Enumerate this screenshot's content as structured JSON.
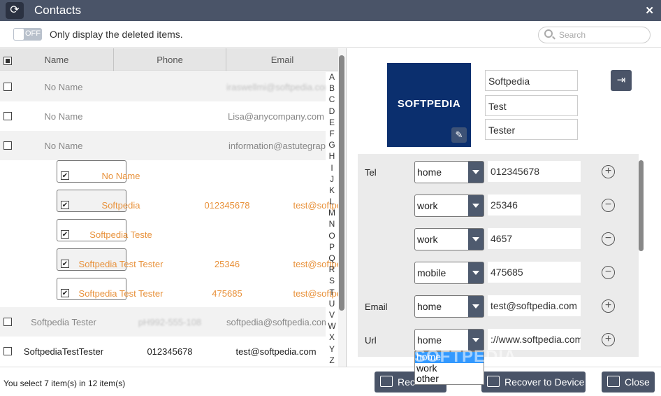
{
  "window": {
    "title": "Contacts",
    "close_glyph": "✕",
    "logo_icon": "refresh-logo-icon"
  },
  "filter": {
    "toggle_label": "OFF",
    "text": "Only display the deleted items.",
    "search_placeholder": "Search"
  },
  "table": {
    "headers": {
      "name": "Name",
      "phone": "Phone",
      "email": "Email"
    },
    "rows": [
      {
        "checked": false,
        "name": "No Name",
        "phone": "",
        "email": "iraswellmi@softpedia.com"
      },
      {
        "checked": false,
        "name": "No Name",
        "phone": "",
        "email": "Lisa@anycompany.com"
      },
      {
        "checked": false,
        "name": "No Name",
        "phone": "",
        "email": "information@astutegraph"
      },
      {
        "checked": true,
        "name": "No Name",
        "phone": "",
        "email": ""
      },
      {
        "checked": true,
        "name": "Softpedia",
        "phone": "012345678",
        "email": "test@softpedia.com"
      },
      {
        "checked": true,
        "name": "Softpedia  Teste",
        "phone": "",
        "email": ""
      },
      {
        "checked": true,
        "name": "Softpedia Test Tester",
        "phone": "25346",
        "email": "test@softpedia.com"
      },
      {
        "checked": true,
        "name": "Softpedia Test Tester",
        "phone": "475685",
        "email": "test@softpedia.com"
      },
      {
        "checked": false,
        "name": "Softpedia Tester",
        "phone": "pH992-555-108",
        "email": "softpedia@softpedia.com"
      },
      {
        "checked": false,
        "name": "SoftpediaTestTester",
        "phone": "012345678",
        "email": "test@softpedia.com"
      }
    ],
    "alphabet": [
      "A",
      "B",
      "C",
      "D",
      "E",
      "F",
      "G",
      "H",
      "I",
      "J",
      "K",
      "L",
      "M",
      "N",
      "O",
      "P",
      "Q",
      "R",
      "S",
      "T",
      "U",
      "V",
      "W",
      "X",
      "Y",
      "Z"
    ]
  },
  "detail": {
    "avatar_text": "SOFTPEDIA",
    "name_fields": [
      "Softpedia",
      "Test",
      "Tester"
    ],
    "tel_label": "Tel",
    "email_label": "Email",
    "url_label": "Url",
    "tel": [
      {
        "type": "home",
        "value": "012345678",
        "action": "+"
      },
      {
        "type": "work",
        "value": "25346",
        "action": "−"
      },
      {
        "type": "work",
        "value": "4657",
        "action": "−"
      },
      {
        "type": "mobile",
        "value": "475685",
        "action": "−"
      }
    ],
    "email": {
      "type": "home",
      "value": "test@softpedia.com",
      "action": "+"
    },
    "url": {
      "type": "home",
      "value": "://www.softpedia.com",
      "action": "+"
    },
    "dropdown_options": [
      "home",
      "work",
      "other"
    ],
    "dropdown_selected": "home"
  },
  "footer": {
    "status": "You select 7 item(s) in 12 item(s)",
    "recover_pc": "Rec",
    "recover_device": "Recover to Device",
    "close": "Close"
  },
  "watermark": "SOFTPEDIA"
}
